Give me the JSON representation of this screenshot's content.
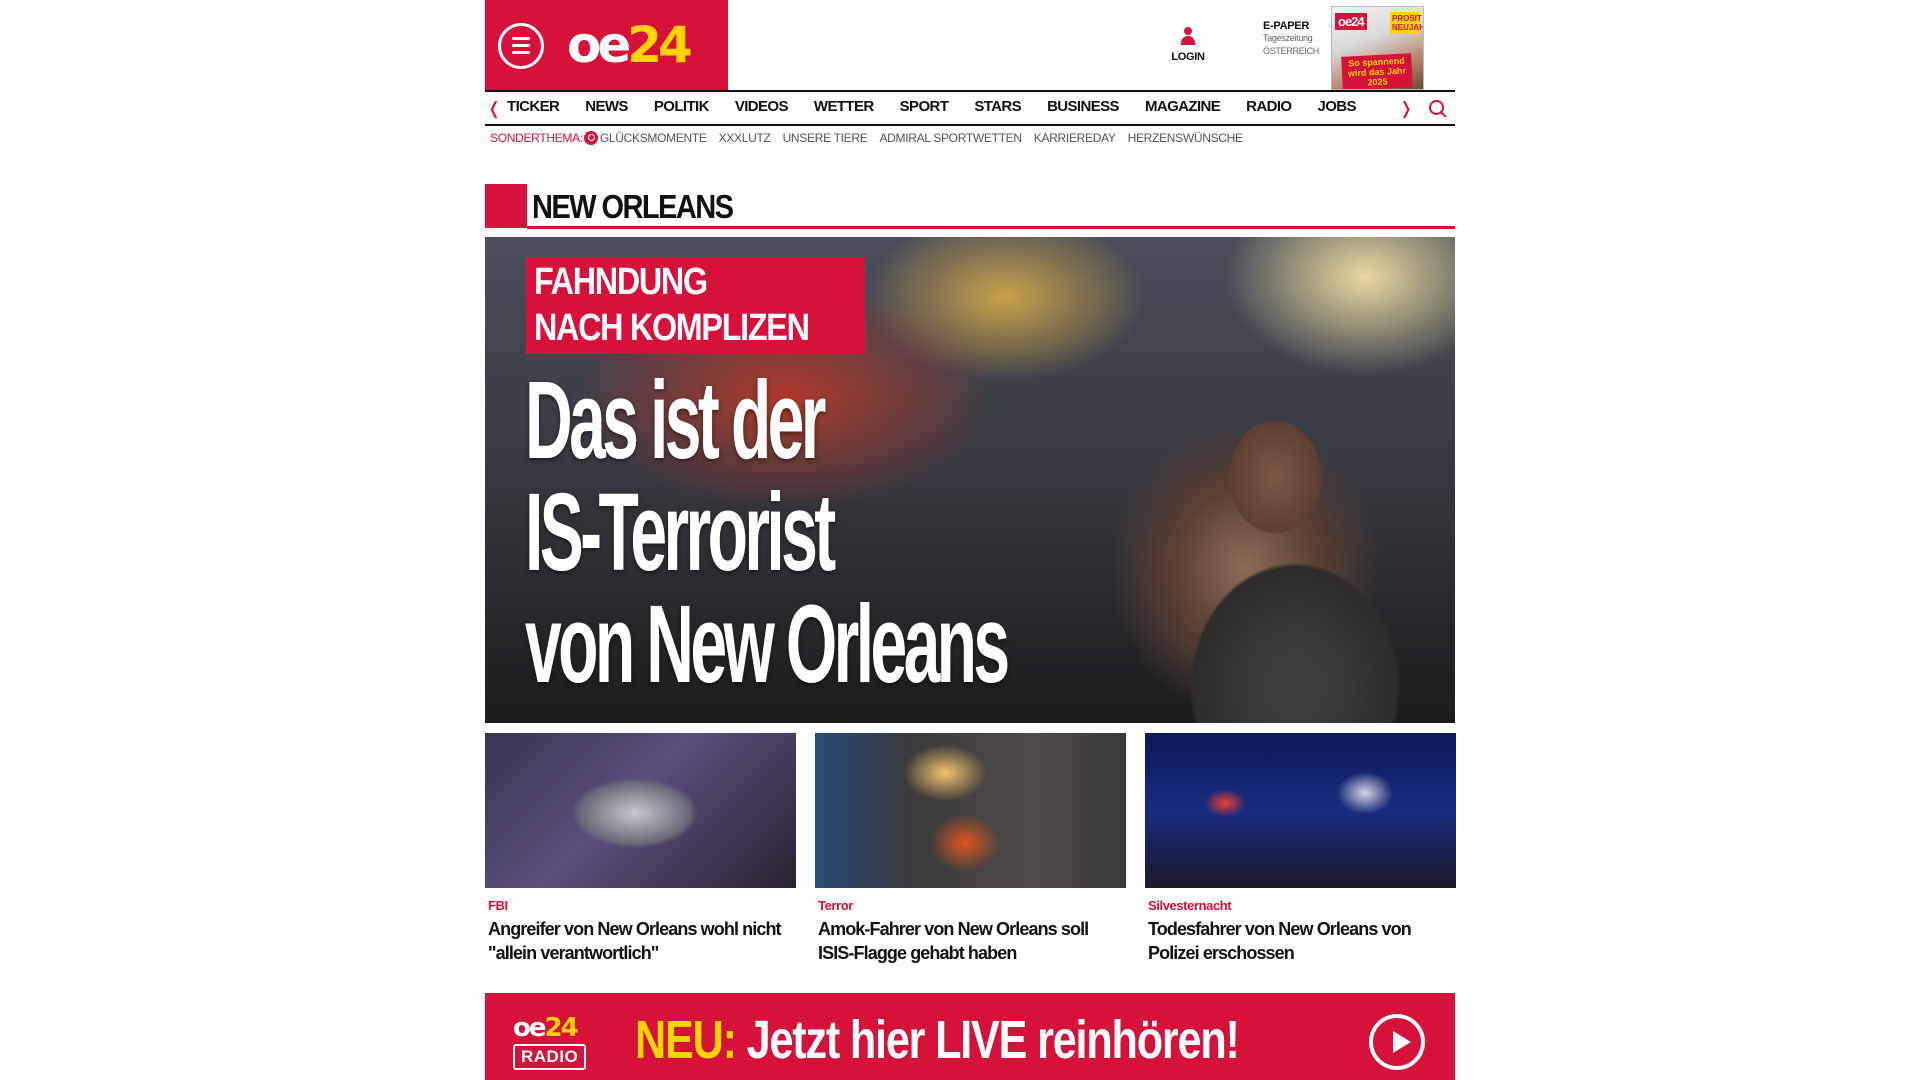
{
  "header": {
    "logo_part1": "oe",
    "logo_part2": "24",
    "login_label": "LOGIN",
    "epaper": {
      "title": "E-PAPER",
      "sub1": "Tageszeitung",
      "sub2": "ÖSTERREICH",
      "cover_logo": "oe24",
      "cover_badge": "PROSIT NEUJAHR!",
      "cover_headline": "So spannend wird das Jahr 2025"
    }
  },
  "nav": {
    "items": [
      "TICKER",
      "NEWS",
      "POLITIK",
      "VIDEOS",
      "WETTER",
      "SPORT",
      "STARS",
      "BUSINESS",
      "MAGAZINE",
      "RADIO",
      "JOBS"
    ],
    "prev_icon": "chevron-left-icon",
    "next_icon": "chevron-right-icon",
    "search_icon": "search-icon"
  },
  "sonderthema": {
    "label": "SONDERTHEMA:",
    "links": [
      "GLÜCKSMOMENTE",
      "XXXLUTZ",
      "UNSERE TIERE",
      "ADMIRAL SPORTWETTEN",
      "KARRIEREDAY",
      "HERZENSWÜNSCHE"
    ]
  },
  "section": {
    "title": "NEW ORLEANS"
  },
  "hero": {
    "badge_line1": "FAHNDUNG",
    "badge_line2": "NACH KOMPLIZEN",
    "headline_line1": "Das ist der",
    "headline_line2": "IS-Terrorist",
    "headline_line3": "von New Orleans"
  },
  "teasers": [
    {
      "category": "FBI",
      "title": "Angreifer von New Orleans wohl nicht \"allein verantwortlich\""
    },
    {
      "category": "Terror",
      "title": "Amok-Fahrer von New Orleans soll ISIS-Flagge gehabt haben"
    },
    {
      "category": "Silvesternacht",
      "title": "Todesfahrer von New Orleans von Polizei erschossen"
    }
  ],
  "radio_banner": {
    "logo_top1": "oe",
    "logo_top2": "24",
    "logo_bottom": "RADIO",
    "neu": "NEU:",
    "cta": "Jetzt hier LIVE reinhören!"
  },
  "colors": {
    "brand_red": "#d6113a",
    "brand_yellow": "#ffd400"
  }
}
